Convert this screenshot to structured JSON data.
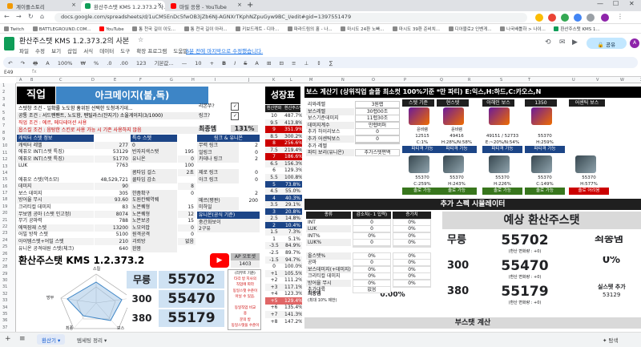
{
  "browser": {
    "tabs": [
      {
        "label": "계이플스토리",
        "color": "#f29900"
      },
      {
        "label": "환산주스탯 KMS 1.2.373.2 사...",
        "color": "#0f9d58"
      },
      {
        "label": "마릴 응용 - YouTube",
        "color": "#ff0000"
      }
    ],
    "url": "docs.google.com/spreadsheets/d/1uCM5EnDc5fwOB3jZb6NJ-AGNXrTKphNZpuGyw9BC_I/edit#gid=1397551479",
    "bookmarks": [
      "Twitch",
      "BATTLEGROUND.COM...",
      "YouTube",
      "통 천국 길이 이도...",
      "통 천국 길이 아라...",
      "키보드캐트 - 디아...",
      "파라드림의 홀 - 나...",
      "마시도 24환 노빠...",
      "마시도 39환 준비치...",
      "디아블로2 인벤게...",
      "나국배틀하 > 나이...",
      "환산주스탯 KMS 1..."
    ]
  },
  "sheets": {
    "title": "환산주스탯 KMS 1.2.373.2의 사본",
    "menus": [
      "파일",
      "수정",
      "보기",
      "삽입",
      "서식",
      "데이터",
      "도구",
      "확장 프로그램",
      "도움말"
    ],
    "last_edit": "6분 전에 마지막으로 수정했습니다.",
    "share_label": "공유",
    "toolbar": [
      "↶",
      "↷",
      "🖶",
      "A",
      "100%",
      "₩",
      "%",
      ".0",
      ".00",
      "123",
      "기본값...",
      "—",
      "10",
      "+",
      "B",
      "I",
      "S",
      "A",
      "⊞",
      "⊟",
      "≡",
      "⊥",
      "↕",
      "∑"
    ],
    "cell_ref": "E49",
    "sheet_tabs": [
      "환산기",
      "템세팅 정리"
    ],
    "explore_label": "탐색"
  },
  "grid": {
    "columns": [
      "A",
      "B",
      "C",
      "D",
      "E",
      "F",
      "G",
      "H",
      "I",
      "J",
      "K",
      "L",
      "M",
      "N",
      "O",
      "P",
      "Q",
      "R",
      "S",
      "T",
      "U",
      "V",
      "W",
      "X"
    ],
    "rows": [
      "1",
      "2",
      "3",
      "4",
      "5",
      "6",
      "7",
      "8",
      "9",
      "10",
      "11",
      "12",
      "13",
      "14",
      "15",
      "16",
      "17",
      "18",
      "19",
      "20",
      "21",
      "22",
      "23",
      "24",
      "25",
      "26",
      "27",
      "28",
      "29",
      "30",
      "31",
      "32",
      "33",
      "34",
      "35",
      "36",
      "37"
    ],
    "job_label": "직업",
    "job_value": "아크메이지(불,독)",
    "left_top": {
      "lines": [
        "스텟창 조건 - 일확률 노도함 훔위된 선택한 도청과기데...",
        "공통 조건 : 서드팬팬트, 노도함, 펜틸라스(잔지기) 소울게이지(3/1000)",
        "직업 조건 : 에르, 메디테이션 사용",
        "옵스킬 조건 : 음탕한 스킨로 사용 가능 시 기존 사용하지 않음"
      ],
      "link_label": "리본쭈?",
      "link2_label": "링크?",
      "final_label": "최종뎀",
      "final_value": "131%"
    },
    "stats": [
      {
        "k": "캐릭터 스텟 정보",
        "v": "",
        "k2": "특수 스텟",
        "v2": ""
      },
      {
        "k": "캐릭터 레벨",
        "v": "277",
        "k2": "0",
        "v2": ""
      },
      {
        "k": "에퓨오 INT(스탯 특징)",
        "v": "53129",
        "k2": "반자지색스탯",
        "v2": "195"
      },
      {
        "k": "에퓨오 INT(스탯 특징)",
        "v": "51770",
        "k2": "유니온",
        "v2": "0"
      },
      {
        "k": "LUK",
        "v": "7763",
        "k2": "",
        "v2": "100"
      },
      {
        "k": "",
        "v": "",
        "k2": "콤타입 걸스",
        "v2": "2초"
      },
      {
        "k": "에퓨오 스텟(역소모)",
        "v": "48,529,721",
        "k2": "쿨타임 감소",
        "v2": ""
      },
      {
        "k": "데미지",
        "v": "90",
        "k2": "",
        "v2": "8"
      },
      {
        "k": "보스 데미지",
        "v": "305",
        "k2": "한좀확구",
        "v2": "0"
      },
      {
        "k": "방어율 무시",
        "v": "93.60",
        "k2": "도원칸퀘역퀘",
        "v2": ""
      },
      {
        "k": "크리티컬 데미지",
        "v": "83",
        "k2": "노몬퀘형",
        "v2": "15"
      },
      {
        "k": "무보엠 공마 (스탯 인고정)",
        "v": "8074",
        "k2": "노몬퀘형",
        "v2": "12"
      },
      {
        "k": "무기 공마력",
        "v": "788",
        "k2": "노몬보공",
        "v2": "15"
      },
      {
        "k": "에픽잠재 스텟",
        "v": "13200",
        "k2": "노모의밥",
        "v2": "0"
      },
      {
        "k": "어빌 방작 스텟",
        "v": "5100",
        "k2": "원격공격",
        "v2": "0"
      },
      {
        "k": "아이템스텟+어빌 스텟",
        "v": "210",
        "k2": "괴뢰방",
        "v2": "없음"
      },
      {
        "k": "유니온 공격대원 스텟(체크)",
        "v": "640",
        "k2": "완몸",
        "v2": ""
      }
    ],
    "links": {
      "header": "링크 & 유니온",
      "rows": [
        [
          "무력 링크",
          "2"
        ],
        [
          "얼링크",
          "0"
        ],
        [
          "카데나 링크",
          "2"
        ],
        [
          "",
          ""
        ],
        [
          "제로 링크",
          "0"
        ],
        [
          "아크 링크",
          "0"
        ],
        [
          "",
          ""
        ],
        [
          "",
          "2"
        ],
        [
          "메르(평판)",
          "200"
        ],
        [
          "미하일",
          ""
        ]
      ],
      "extra": [
        "유니온(공식 기준)",
        "중간화보이",
        "2구유"
      ]
    },
    "mastery": {
      "title": "성장표",
      "header": [
        "환산변화",
        "환산주스탯"
      ],
      "rows": [
        [
          "10",
          "487.7%"
        ],
        [
          "9.5",
          "413.8%"
        ],
        [
          "9",
          "351.9%"
        ],
        [
          "8.5",
          "300.2%"
        ],
        [
          "8",
          "256.6%"
        ],
        [
          "7.5",
          "219.4%"
        ],
        [
          "7",
          "186.6%"
        ],
        [
          "6.5",
          "156.3%"
        ],
        [
          "6",
          "129.3%"
        ],
        [
          "5.5",
          "100.8%"
        ],
        [
          "5",
          "73.8%"
        ],
        [
          "4.5",
          "55.0%"
        ],
        [
          "4",
          "40.3%"
        ],
        [
          "3.5",
          "29.1%"
        ],
        [
          "3",
          "20.8%"
        ],
        [
          "2.5",
          "14.8%"
        ],
        [
          "2",
          "10.4%"
        ],
        [
          "1.5",
          "7.3%"
        ],
        [
          "1",
          "5.1%"
        ],
        [
          "-3.5",
          "84.9%"
        ],
        [
          "-2.5",
          "89.7%"
        ],
        [
          "-1.5",
          "94.7%"
        ],
        [
          "0",
          "100.0%"
        ],
        [
          "+1",
          "105.5%"
        ],
        [
          "+2",
          "111.2%"
        ],
        [
          "+3",
          "117.1%"
        ],
        [
          "+4",
          "123.3%"
        ],
        [
          "+5",
          "129.4%"
        ],
        [
          "+6",
          "135.4%"
        ],
        [
          "+7",
          "141.3%"
        ],
        [
          "+8",
          "147.2%"
        ]
      ]
    },
    "boss": {
      "title": "보스 계산기 (상위직업 솔플 최소컷 100%기준 *만 파티) E:익스,H:하드,C:카오스,N",
      "names": [
        "스텟 기준",
        "현스텟",
        "아헤인 보스",
        "1350",
        "어센틱 보스"
      ],
      "left_rows": [
        [
          "리와레벨",
          "3원렙"
        ],
        [
          "보스레벨",
          "30렙00조"
        ],
        [
          "보스기준데미지",
          "11렙30조"
        ],
        [
          "데미지계수",
          "만렙버퍼"
        ],
        [
          "추가 하이리보스",
          "0"
        ],
        [
          "추가 어센틱보스",
          "0"
        ],
        [
          "추가 레벨",
          ""
        ],
        [
          "파티 보리(유니온)",
          "추가스텟편백"
        ]
      ],
      "cards": [
        {
          "name": "윤비렘",
          "val1": "12515",
          "val2": "C:1%",
          "status": "파티격 가능"
        },
        {
          "name": "윤비렘",
          "val1": "49416",
          "val2": "H:28%/N:58%",
          "status": "파티격 가능"
        },
        {
          "name": "",
          "val1": "49151 / 52733",
          "val2": "E:~20%/N:54%",
          "status": "파티격 가능"
        },
        {
          "name": "",
          "val1": "55370",
          "val2": "H:259%",
          "status": "파티격 가능"
        }
      ],
      "cards2": [
        {
          "val1": "55370",
          "val2": "C:259%",
          "status": "솔로 가능"
        },
        {
          "val1": "55370",
          "val2": "H:243%",
          "status": "솔로 가능"
        },
        {
          "val1": "55370",
          "val2": "H:226%",
          "status": "솔로 가능"
        },
        {
          "val1": "55370",
          "val2": "C:149%",
          "status": "솔로 가능"
        },
        {
          "val1": "55370",
          "val2": "H:577%",
          "status": "솔로 어려움"
        }
      ]
    },
    "sim": {
      "title": "추가 스펙 시뮬레이터",
      "headers": [
        "종류",
        "감소치(- 1 입력)",
        "증가치"
      ],
      "rows": [
        [
          "INT",
          "0",
          "0%"
        ],
        [
          "LUK",
          "0",
          "0%"
        ],
        [
          "INT%",
          "0%",
          "0%"
        ],
        [
          "LUK%",
          "0",
          "0%"
        ],
        [
          "",
          "",
          ""
        ],
        [
          "올스탯%",
          "0%",
          "0%"
        ],
        [
          "공마",
          "0",
          "0%"
        ],
        [
          "보스데미지(+데미지)",
          "0%",
          "0%"
        ],
        [
          "크리티컬 데미지",
          "0%",
          "0%"
        ],
        [
          "방어율 무시",
          "0%",
          "0%"
        ],
        [
          "추가대륙",
          "없음",
          ""
        ]
      ],
      "final_label": "최종뎀",
      "final_sub": "(최대 10% 제한)",
      "final_value": "0.00%"
    },
    "predict": {
      "title": "예상 환산주스탯",
      "rows": [
        {
          "label": "무릉",
          "value": "55702",
          "sub": "(환산 변화량 : +0)"
        },
        {
          "label": "300",
          "value": "55470",
          "sub": "(환산 변화량 : +0)"
        },
        {
          "label": "380",
          "value": "55179",
          "sub": "(환산 변화량 : +0)"
        }
      ],
      "right_label": "최종댐",
      "right_value": "0%",
      "right_sub": "실스텟 추가",
      "right_sub_value": "53129"
    },
    "substat": {
      "title": "부스탯 계산"
    },
    "summary": {
      "title": "환산주스탯 KMS 1.2.373.2",
      "ap_label": "AP 오토셋",
      "ap_value": "1403",
      "rows": [
        {
          "label": "무릉",
          "value": "55702"
        },
        {
          "label": "300",
          "value": "55470"
        },
        {
          "label": "380",
          "value": "55179"
        }
      ],
      "radar_labels": [
        "스킬",
        "공격",
        "보스",
        "최종",
        "방무"
      ],
      "note_lines": [
        "(리부트 기준)",
        "타각 방 지사의",
        "직업에 따라",
        "동일스탯 수준이",
        "아닐 수 있음.",
        "",
        "동일직업 비교",
        "용",
        "문의 방",
        "동일스탯을 수준이"
      ]
    }
  }
}
